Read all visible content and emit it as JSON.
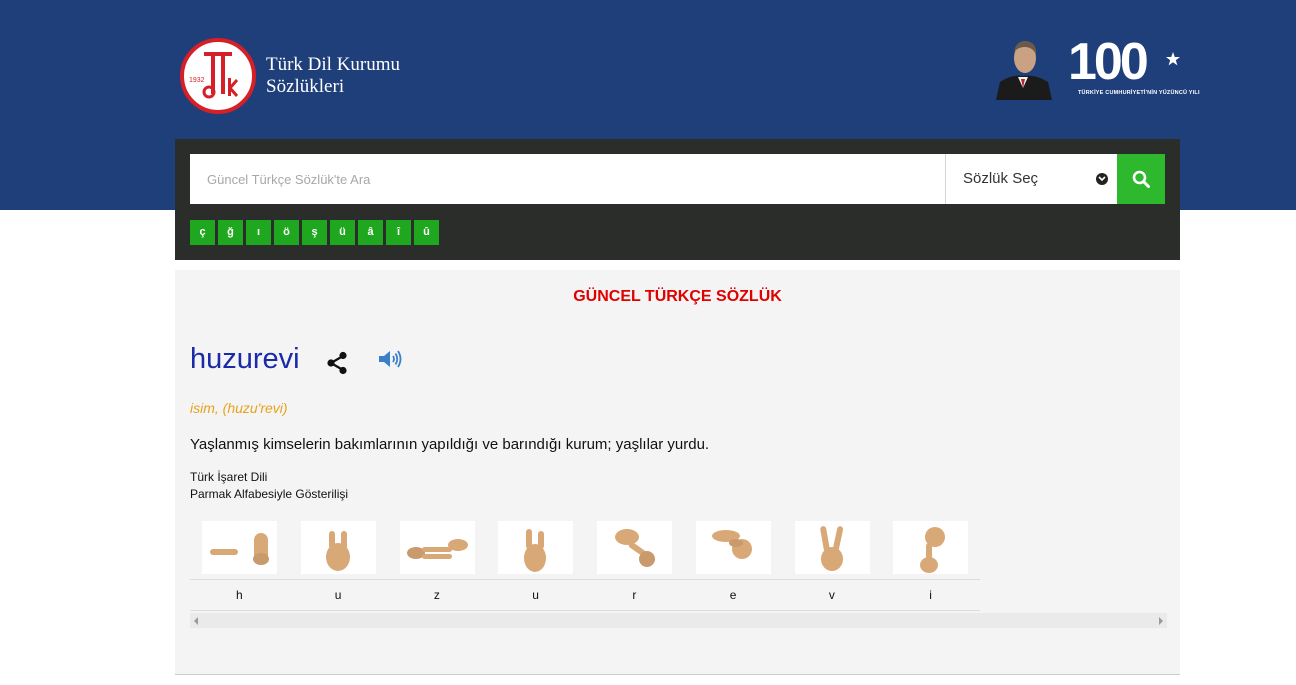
{
  "header": {
    "logo_year": "1932",
    "logo_letters": "tdk",
    "brand_line1": "Türk Dil Kurumu",
    "brand_line2": "Sözlükleri",
    "centennial_number": "100",
    "centennial_caption": "TÜRKİYE CUMHURİYETİ'NİN YÜZÜNCÜ YILI",
    "colors": {
      "band": "#1f3f7a",
      "logo_red": "#d61f26"
    }
  },
  "search": {
    "placeholder": "Güncel Türkçe Sözlük'te Ara",
    "value": "",
    "dictionary_select": "Sözlük Seç",
    "submit_icon": "search-icon",
    "special_letters": [
      "ç",
      "ğ",
      "ı",
      "ö",
      "ş",
      "ü",
      "â",
      "î",
      "û"
    ],
    "colors": {
      "button": "#2eb82e",
      "letter_buttons": "#1fa81f"
    }
  },
  "entry": {
    "section_title": "GÜNCEL TÜRKÇE SÖZLÜK",
    "word": "huzurevi",
    "share_icon": "share-icon",
    "audio_icon": "speaker-icon",
    "grammar": "isim, (huzu'revi)",
    "definition": "Yaşlanmış kimselerin bakımlarının yapıldığı ve barındığı kurum; yaşlılar yurdu.",
    "sign_language_title": "Türk İşaret Dili",
    "sign_language_subtitle": "Parmak Alfabesiyle Gösterilişi",
    "fingerspelling": [
      "h",
      "u",
      "z",
      "u",
      "r",
      "e",
      "v",
      "i"
    ],
    "colors": {
      "title": "#e00000",
      "word": "#1a2aa8",
      "grammar": "#e8a21c"
    }
  }
}
